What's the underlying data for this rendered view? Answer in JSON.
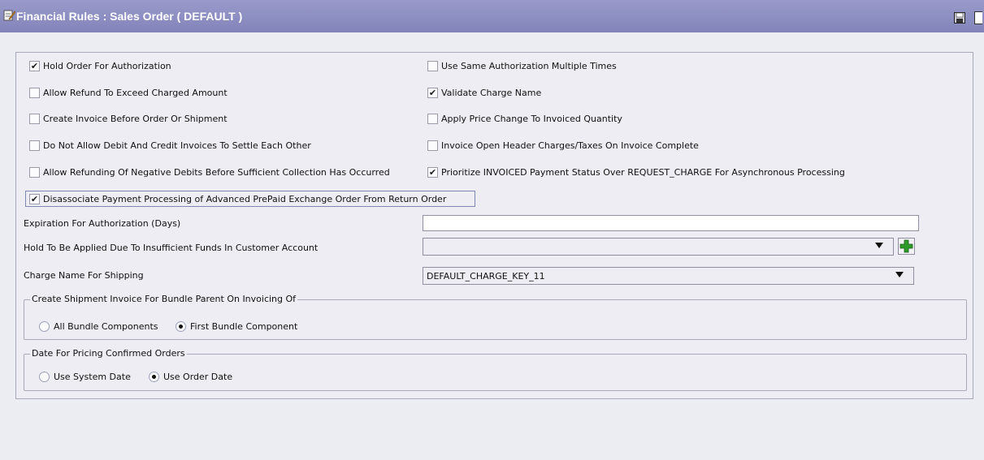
{
  "window": {
    "title": "Financial Rules : Sales Order ( DEFAULT )",
    "title_icon": "rules-document-icon",
    "save_icon": "floppy-disk-icon",
    "titlebar_color": "#8a8bc0"
  },
  "checkboxes": [
    {
      "label": "Hold Order For Authorization",
      "checked": true,
      "checked_mark": "✔"
    },
    {
      "label": "Use Same Authorization Multiple Times",
      "checked": false,
      "checked_mark": ""
    },
    {
      "label": "Allow Refund To Exceed Charged Amount",
      "checked": false,
      "checked_mark": ""
    },
    {
      "label": "Validate Charge Name",
      "checked": true,
      "checked_mark": "✔"
    },
    {
      "label": "Create Invoice Before Order Or Shipment",
      "checked": false,
      "checked_mark": ""
    },
    {
      "label": "Apply Price Change To Invoiced Quantity",
      "checked": false,
      "checked_mark": ""
    },
    {
      "label": "Do Not Allow Debit And Credit Invoices To Settle Each Other",
      "checked": false,
      "checked_mark": ""
    },
    {
      "label": "Invoice Open Header Charges/Taxes On Invoice Complete",
      "checked": false,
      "checked_mark": ""
    },
    {
      "label": "Allow Refunding Of Negative Debits Before Sufficient Collection Has Occurred",
      "checked": false,
      "checked_mark": ""
    },
    {
      "label": "Prioritize INVOICED Payment Status Over REQUEST_CHARGE For Asynchronous Processing",
      "checked": true,
      "checked_mark": "✔"
    },
    {
      "label": "Disassociate Payment Processing of Advanced PrePaid Exchange Order From Return Order",
      "checked": true,
      "checked_mark": "✔"
    }
  ],
  "fields": {
    "expiration_label": "Expiration For Authorization (Days)",
    "expiration_value": "",
    "hold_label": "Hold To Be Applied Due To Insufficient Funds In Customer Account",
    "hold_value": "",
    "charge_label": "Charge Name For Shipping",
    "charge_value": "DEFAULT_CHARGE_KEY_11"
  },
  "bundle_group": {
    "title": "Create Shipment Invoice For Bundle Parent On Invoicing Of",
    "options": [
      {
        "label": "All Bundle Components",
        "selected": false
      },
      {
        "label": "First Bundle Component",
        "selected": true
      }
    ]
  },
  "pricing_group": {
    "title": "Date For Pricing Confirmed Orders",
    "options": [
      {
        "label": "Use System Date",
        "selected": false
      },
      {
        "label": "Use Order Date",
        "selected": true
      }
    ]
  }
}
